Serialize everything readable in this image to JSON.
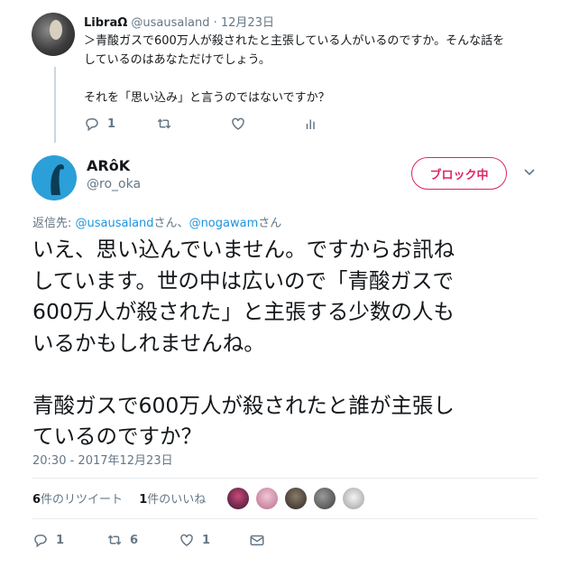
{
  "reply_tweet": {
    "name": "LibraΩ",
    "handle": "@usausaland",
    "separator": "·",
    "date": "12月23日",
    "text_lines": [
      "＞青酸ガスで600万人が殺されたと主張している人がいるのですか。そんな話を",
      "しているのはあなただけでしょう。",
      "それを「思い込み」と言うのではないですか？"
    ],
    "reply_count": "1",
    "retweet_count": "",
    "like_count": ""
  },
  "main_tweet": {
    "name": "ARôK",
    "handle": "@ro_oka",
    "block_button": "ブロック中",
    "replying_prefix": "返信先: ",
    "replying_user1": "@usausaland",
    "replying_sep": "さん、",
    "replying_user2": "@nogawam",
    "replying_suffix": "さん",
    "text_lines": [
      "いえ、思い込んでいません。ですからお訊ね",
      "しています。世の中は広いので「青酸ガスで",
      "600万人が殺された」と主張する少数の人も",
      "いるかもしれませんね。",
      "青酸ガスで600万人が殺されたと誰が主張し",
      "ているのですか？"
    ],
    "timestamp": "20:30 - 2017年12月23日",
    "retweets_count": "6",
    "retweets_label": "件のリツイート",
    "likes_count": "1",
    "likes_label": "件のいいね",
    "reply_count": "1",
    "retweet_count": "6",
    "like_count": "1"
  },
  "colors": {
    "accent_blue": "#1b95e0",
    "block_red": "#e0245e",
    "muted": "#657786",
    "text": "#14171a",
    "divider": "#e6ecf0"
  },
  "icons": [
    "reply-icon",
    "retweet-icon",
    "like-icon",
    "analytics-icon",
    "dm-icon",
    "chevron-down-icon"
  ]
}
